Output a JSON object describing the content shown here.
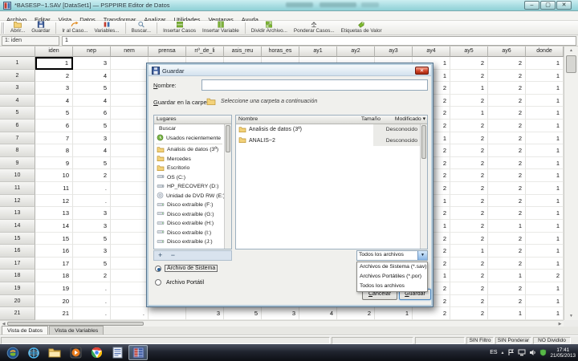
{
  "titlebar": {
    "title": "*BASESP~1.SAV [DataSet1] — PSPPIRE Editor de Datos",
    "controls": {
      "minimize": "–",
      "maximize": "▢",
      "close": "✕"
    }
  },
  "menubar": {
    "items": [
      "Archivo",
      "Editar",
      "Vista",
      "Datos",
      "Transformar",
      "Analizar",
      "Utilidades",
      "Ventanas",
      "Ayuda"
    ]
  },
  "toolbar": {
    "separators_after": [
      1,
      3,
      4,
      6
    ],
    "buttons": [
      {
        "label": "Abrir...",
        "icon": "open-folder-icon"
      },
      {
        "label": "Guardar",
        "icon": "save-floppy-icon"
      },
      {
        "label": "Ir al Caso...",
        "icon": "goto-case-icon"
      },
      {
        "label": "Variables...",
        "icon": "variables-icon"
      },
      {
        "label": "Buscar...",
        "icon": "search-icon"
      },
      {
        "label": "Insertar Casos",
        "icon": "insert-cases-icon"
      },
      {
        "label": "Insertar Variable",
        "icon": "insert-variable-icon"
      },
      {
        "label": "Dividir Archivo...",
        "icon": "split-file-icon"
      },
      {
        "label": "Ponderar Casos...",
        "icon": "weight-cases-icon"
      },
      {
        "label": "Etiquetas de Valor",
        "icon": "value-labels-icon"
      }
    ]
  },
  "cellref": {
    "reference": "1: iden",
    "value": "1"
  },
  "grid": {
    "columns": [
      "iden",
      "nep",
      "nem",
      "prensa",
      "nº_de_li",
      "asis_reu",
      "horas_es",
      "ay1",
      "ay2",
      "ay3",
      "ay4",
      "ay5",
      "ay6",
      "donde"
    ],
    "rows": [
      {
        "n": "1",
        "c": [
          "1",
          "3",
          "",
          "",
          "",
          "",
          "",
          "",
          "",
          "",
          "1",
          "2",
          "2",
          "1"
        ]
      },
      {
        "n": "2",
        "c": [
          "2",
          "4",
          "",
          "",
          "",
          "",
          "",
          "",
          "",
          "",
          "1",
          "2",
          "2",
          "1"
        ]
      },
      {
        "n": "3",
        "c": [
          "3",
          "5",
          "",
          "",
          "",
          "",
          "",
          "",
          "",
          "",
          "2",
          "1",
          "2",
          "1"
        ]
      },
      {
        "n": "4",
        "c": [
          "4",
          "4",
          "",
          "",
          "",
          "",
          "",
          "",
          "",
          "",
          "2",
          "2",
          "2",
          "1"
        ]
      },
      {
        "n": "5",
        "c": [
          "5",
          "6",
          "",
          "",
          "",
          "",
          "",
          "",
          "",
          "",
          "2",
          "1",
          "2",
          "1"
        ]
      },
      {
        "n": "6",
        "c": [
          "6",
          "5",
          "",
          "",
          "",
          "",
          "",
          "",
          "",
          "",
          "2",
          "2",
          "2",
          "1"
        ]
      },
      {
        "n": "7",
        "c": [
          "7",
          "3",
          "",
          "",
          "",
          "",
          "",
          "",
          "",
          "",
          "1",
          "2",
          "2",
          "1"
        ]
      },
      {
        "n": "8",
        "c": [
          "8",
          "4",
          "",
          "",
          "",
          "",
          "",
          "",
          "",
          "",
          "2",
          "2",
          "2",
          "1"
        ]
      },
      {
        "n": "9",
        "c": [
          "9",
          "5",
          "",
          "",
          "",
          "",
          "",
          "",
          "",
          "",
          "2",
          "2",
          "2",
          "1"
        ]
      },
      {
        "n": "10",
        "c": [
          "10",
          "2",
          "",
          "",
          "",
          "",
          "",
          "",
          "",
          "",
          "2",
          "2",
          "2",
          "1"
        ]
      },
      {
        "n": "11",
        "c": [
          "11",
          ".",
          "",
          "",
          "",
          "",
          "",
          "",
          "",
          "",
          "2",
          "2",
          "2",
          "1"
        ]
      },
      {
        "n": "12",
        "c": [
          "12",
          ".",
          "",
          "",
          "",
          "",
          "",
          "",
          "",
          "",
          "1",
          "2",
          "2",
          "1"
        ]
      },
      {
        "n": "13",
        "c": [
          "13",
          "3",
          "",
          "",
          "",
          "",
          "",
          "",
          "",
          "",
          "2",
          "2",
          "2",
          "1"
        ]
      },
      {
        "n": "14",
        "c": [
          "14",
          "3",
          "",
          "",
          "",
          "",
          "",
          "",
          "",
          "",
          "1",
          "2",
          "1",
          "1"
        ]
      },
      {
        "n": "15",
        "c": [
          "15",
          "5",
          "",
          "",
          "",
          "",
          "",
          "",
          "",
          "",
          "2",
          "2",
          "2",
          "1"
        ]
      },
      {
        "n": "16",
        "c": [
          "16",
          "3",
          "",
          "",
          "",
          "",
          "",
          "",
          "",
          "",
          "2",
          "1",
          "2",
          "1"
        ]
      },
      {
        "n": "17",
        "c": [
          "17",
          "5",
          "",
          "",
          "",
          "",
          "",
          "",
          "",
          "",
          "2",
          "2",
          "2",
          "1"
        ]
      },
      {
        "n": "18",
        "c": [
          "18",
          "2",
          "",
          "",
          "",
          "",
          "",
          "",
          "",
          "",
          "1",
          "2",
          "1",
          "2"
        ]
      },
      {
        "n": "19",
        "c": [
          "19",
          ".",
          "",
          "",
          "",
          "",
          "",
          "",
          "",
          "",
          "2",
          "2",
          "2",
          "1"
        ]
      },
      {
        "n": "20",
        "c": [
          "20",
          ".",
          "",
          "",
          "",
          "",
          "",
          "",
          "",
          "",
          "2",
          "2",
          "2",
          "1"
        ]
      },
      {
        "n": "21",
        "c": [
          "21",
          ".",
          ".",
          "",
          "3",
          "5",
          "3",
          "4",
          "2",
          "1",
          "2",
          "2",
          "1",
          "1"
        ]
      }
    ]
  },
  "dialog": {
    "title": "Guardar",
    "close": "✕",
    "name_label": "Nombre:",
    "name_value": "",
    "folder_label": "Guardar en la carpeta:",
    "folder_hint": "Seleccione una carpeta a continuación",
    "places": {
      "header": "Lugares",
      "items": [
        {
          "label": "Buscar",
          "icon": "search-icon"
        },
        {
          "label": "Usados recientemente",
          "icon": "recent-icon"
        },
        {
          "label": "Analisis de datos (3ª)",
          "icon": "folder-icon"
        },
        {
          "label": "Mercedes",
          "icon": "folder-icon"
        },
        {
          "label": "Escritorio",
          "icon": "folder-icon"
        },
        {
          "label": "OS (C:)",
          "icon": "drive-icon"
        },
        {
          "label": "HP_RECOVERY (D:)",
          "icon": "drive-icon"
        },
        {
          "label": "Unidad de DVD RW (E:)",
          "icon": "optical-drive-icon"
        },
        {
          "label": "Disco extraíble (F:)",
          "icon": "removable-drive-icon"
        },
        {
          "label": "Disco extraíble (G:)",
          "icon": "removable-drive-icon"
        },
        {
          "label": "Disco extraíble (H:)",
          "icon": "removable-drive-icon"
        },
        {
          "label": "Disco extraíble (I:)",
          "icon": "removable-drive-icon"
        },
        {
          "label": "Disco extraíble (J:)",
          "icon": "removable-drive-icon"
        }
      ]
    },
    "add_remove": "+ −",
    "files": {
      "header_name": "Nombre",
      "header_size": "Tamaño",
      "header_modified": "Modificado ▾",
      "items": [
        {
          "name": "Analisis de datos (3ª)",
          "modified": "Desconocido"
        },
        {
          "name": "ANALIS~2",
          "modified": "Desconocido"
        }
      ]
    },
    "filetype_combo": {
      "value": "Todos los archivos",
      "options": [
        "Archivos de Sistema (*.sav)",
        "Archivos Portátiles (*.por)",
        "Todos los archivos"
      ]
    },
    "radios": [
      {
        "label": "Archivo de Sistema",
        "selected": true
      },
      {
        "label": "Archivo Portátil",
        "selected": false
      }
    ],
    "buttons": {
      "cancel": "Cancelar",
      "save": "Guardar"
    }
  },
  "tabs": {
    "items": [
      "Vista de Datos",
      "Vista de Variables"
    ],
    "active": 0
  },
  "statusbar": {
    "cells": [
      "",
      "",
      "",
      "SIN Filtro",
      "SIN Ponderar",
      "NO Dividido"
    ]
  },
  "taskbar": {
    "icons": [
      "start",
      "internet-explorer",
      "file-explorer",
      "media-player",
      "chrome",
      "word",
      "pspp"
    ],
    "tray": {
      "language": "ES",
      "arrow": "▲",
      "time": "17:41",
      "date": "21/05/2013"
    }
  }
}
